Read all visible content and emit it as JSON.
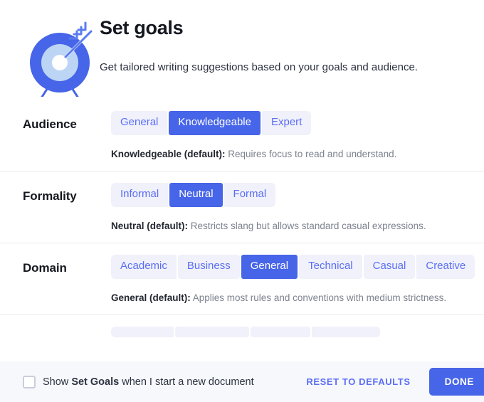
{
  "header": {
    "icon": "target-with-arrow-icon",
    "title": "Set goals",
    "subtitle": "Get tailored writing suggestions based on your goals and audience."
  },
  "colors": {
    "accent": "#4765e8",
    "pill_text": "#5b6ef5",
    "pill_background": "#f0f1fa",
    "footer_background": "#f7f8fc",
    "heading": "#14181f",
    "description": "#7c828e"
  },
  "sections": [
    {
      "label": "Audience",
      "options": [
        "General",
        "Knowledgeable",
        "Expert"
      ],
      "selected": "Knowledgeable",
      "desc_label": "Knowledgeable (default):",
      "desc_text": " Requires focus to read and understand."
    },
    {
      "label": "Formality",
      "options": [
        "Informal",
        "Neutral",
        "Formal"
      ],
      "selected": "Neutral",
      "desc_label": "Neutral (default):",
      "desc_text": " Restricts slang but allows standard casual expressions."
    },
    {
      "label": "Domain",
      "options": [
        "Academic",
        "Business",
        "General",
        "Technical",
        "Casual",
        "Creative"
      ],
      "selected": "General",
      "desc_label": "General (default):",
      "desc_text": " Applies most rules and conventions with medium strictness."
    }
  ],
  "clipped_section": {
    "label": "",
    "options": [
      "",
      "",
      "",
      ""
    ],
    "selected": ""
  },
  "footer": {
    "checkbox_checked": false,
    "checkbox_prefix": "Show ",
    "checkbox_bold": "Set Goals",
    "checkbox_suffix": " when I start a new document",
    "reset_label": "RESET TO DEFAULTS",
    "done_label": "DONE"
  }
}
